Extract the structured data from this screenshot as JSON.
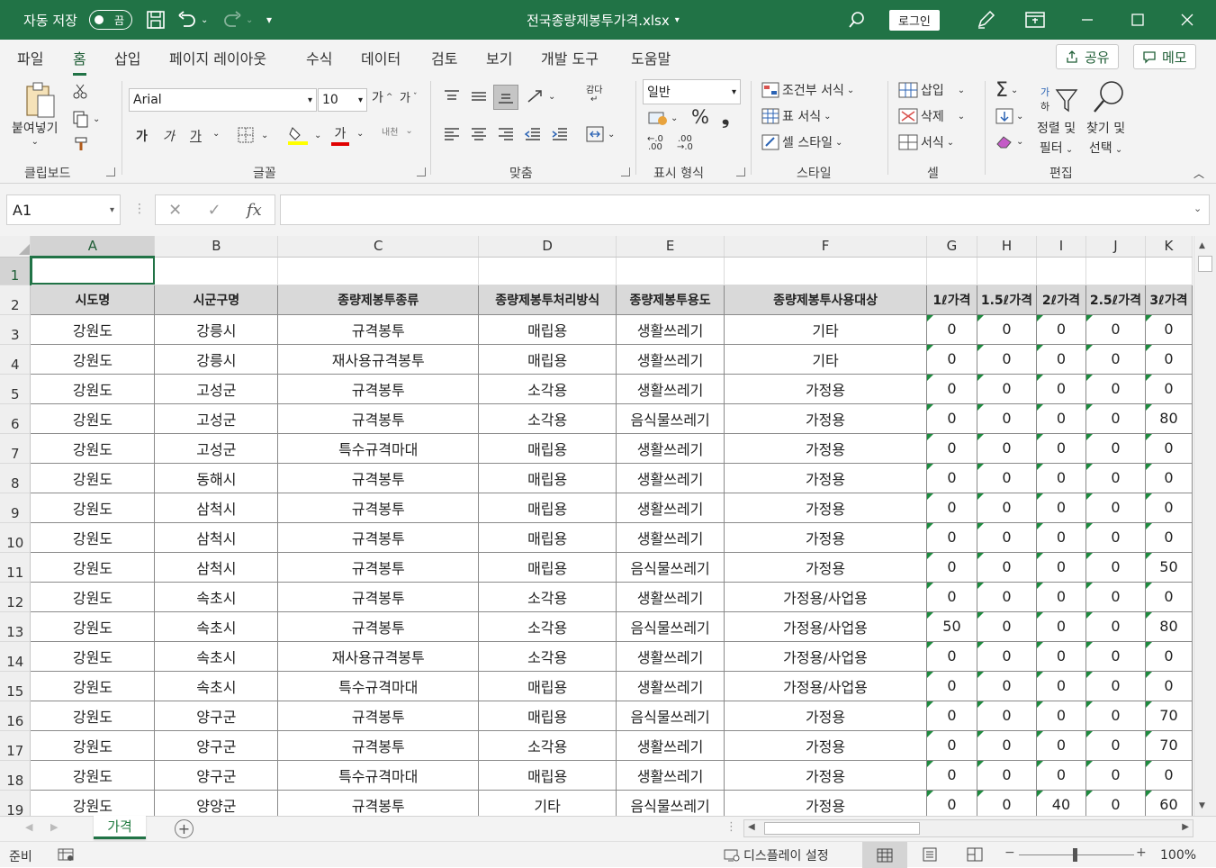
{
  "titlebar": {
    "autosave_label": "자동 저장",
    "autosave_state": "끔",
    "filename": "전국종량제봉투가격.xlsx",
    "login": "로그인"
  },
  "tabs": [
    "파일",
    "홈",
    "삽입",
    "페이지 레이아웃",
    "수식",
    "데이터",
    "검토",
    "보기",
    "개발 도구",
    "도움말"
  ],
  "active_tab": "홈",
  "share_label": "공유",
  "memo_label": "메모",
  "ribbon": {
    "clipboard": {
      "paste": "붙여넣기",
      "label": "클립보드"
    },
    "font": {
      "name": "Arial",
      "size": "10",
      "bold": "가",
      "italic": "가",
      "underline": "가",
      "phonetic": "내천",
      "label": "글꼴"
    },
    "alignment": {
      "wrap": "감다",
      "label": "맞춤"
    },
    "number": {
      "format": "일반",
      "label": "표시 형식"
    },
    "styles": {
      "conditional": "조건부 서식",
      "table": "표 서식",
      "cell": "셀 스타일",
      "label": "스타일"
    },
    "cells": {
      "insert": "삽입",
      "delete": "삭제",
      "format": "서식",
      "label": "셀"
    },
    "editing": {
      "sort1": "정렬 및",
      "sort2": "필터",
      "find1": "찾기 및",
      "find2": "선택",
      "label": "편집"
    }
  },
  "namebox": "A1",
  "columns": [
    "A",
    "B",
    "C",
    "D",
    "E",
    "F",
    "G",
    "H",
    "I",
    "J",
    "K"
  ],
  "row_numbers": [
    "1",
    "2",
    "3",
    "4",
    "5",
    "6",
    "7",
    "8",
    "9",
    "10",
    "11",
    "12",
    "13",
    "14",
    "15",
    "16",
    "17",
    "18",
    "19"
  ],
  "headers": [
    "시도명",
    "시군구명",
    "종량제봉투종류",
    "종량제봉투처리방식",
    "종량제봉투용도",
    "종량제봉투사용대상",
    "1ℓ가격",
    "1.5ℓ가격",
    "2ℓ가격",
    "2.5ℓ가격",
    "3ℓ가격"
  ],
  "rows": [
    [
      "강원도",
      "강릉시",
      "규격봉투",
      "매립용",
      "생활쓰레기",
      "기타",
      "0",
      "0",
      "0",
      "0",
      "0"
    ],
    [
      "강원도",
      "강릉시",
      "재사용규격봉투",
      "매립용",
      "생활쓰레기",
      "기타",
      "0",
      "0",
      "0",
      "0",
      "0"
    ],
    [
      "강원도",
      "고성군",
      "규격봉투",
      "소각용",
      "생활쓰레기",
      "가정용",
      "0",
      "0",
      "0",
      "0",
      "0"
    ],
    [
      "강원도",
      "고성군",
      "규격봉투",
      "소각용",
      "음식물쓰레기",
      "가정용",
      "0",
      "0",
      "0",
      "0",
      "80"
    ],
    [
      "강원도",
      "고성군",
      "특수규격마대",
      "매립용",
      "생활쓰레기",
      "가정용",
      "0",
      "0",
      "0",
      "0",
      "0"
    ],
    [
      "강원도",
      "동해시",
      "규격봉투",
      "매립용",
      "생활쓰레기",
      "가정용",
      "0",
      "0",
      "0",
      "0",
      "0"
    ],
    [
      "강원도",
      "삼척시",
      "규격봉투",
      "매립용",
      "생활쓰레기",
      "가정용",
      "0",
      "0",
      "0",
      "0",
      "0"
    ],
    [
      "강원도",
      "삼척시",
      "규격봉투",
      "매립용",
      "생활쓰레기",
      "가정용",
      "0",
      "0",
      "0",
      "0",
      "0"
    ],
    [
      "강원도",
      "삼척시",
      "규격봉투",
      "매립용",
      "음식물쓰레기",
      "가정용",
      "0",
      "0",
      "0",
      "0",
      "50"
    ],
    [
      "강원도",
      "속초시",
      "규격봉투",
      "소각용",
      "생활쓰레기",
      "가정용/사업용",
      "0",
      "0",
      "0",
      "0",
      "0"
    ],
    [
      "강원도",
      "속초시",
      "규격봉투",
      "소각용",
      "음식물쓰레기",
      "가정용/사업용",
      "50",
      "0",
      "0",
      "0",
      "80"
    ],
    [
      "강원도",
      "속초시",
      "재사용규격봉투",
      "소각용",
      "생활쓰레기",
      "가정용/사업용",
      "0",
      "0",
      "0",
      "0",
      "0"
    ],
    [
      "강원도",
      "속초시",
      "특수규격마대",
      "매립용",
      "생활쓰레기",
      "가정용/사업용",
      "0",
      "0",
      "0",
      "0",
      "0"
    ],
    [
      "강원도",
      "양구군",
      "규격봉투",
      "매립용",
      "음식물쓰레기",
      "가정용",
      "0",
      "0",
      "0",
      "0",
      "70"
    ],
    [
      "강원도",
      "양구군",
      "규격봉투",
      "소각용",
      "생활쓰레기",
      "가정용",
      "0",
      "0",
      "0",
      "0",
      "70"
    ],
    [
      "강원도",
      "양구군",
      "특수규격마대",
      "매립용",
      "생활쓰레기",
      "가정용",
      "0",
      "0",
      "0",
      "0",
      "0"
    ],
    [
      "강원도",
      "양양군",
      "규격봉투",
      "기타",
      "음식물쓰레기",
      "가정용",
      "0",
      "0",
      "40",
      "0",
      "60"
    ]
  ],
  "sheet_tab": "가격",
  "status": {
    "ready": "준비",
    "display_settings": "디스플레이 설정",
    "zoom": "100%"
  },
  "accent_color": "#217346"
}
